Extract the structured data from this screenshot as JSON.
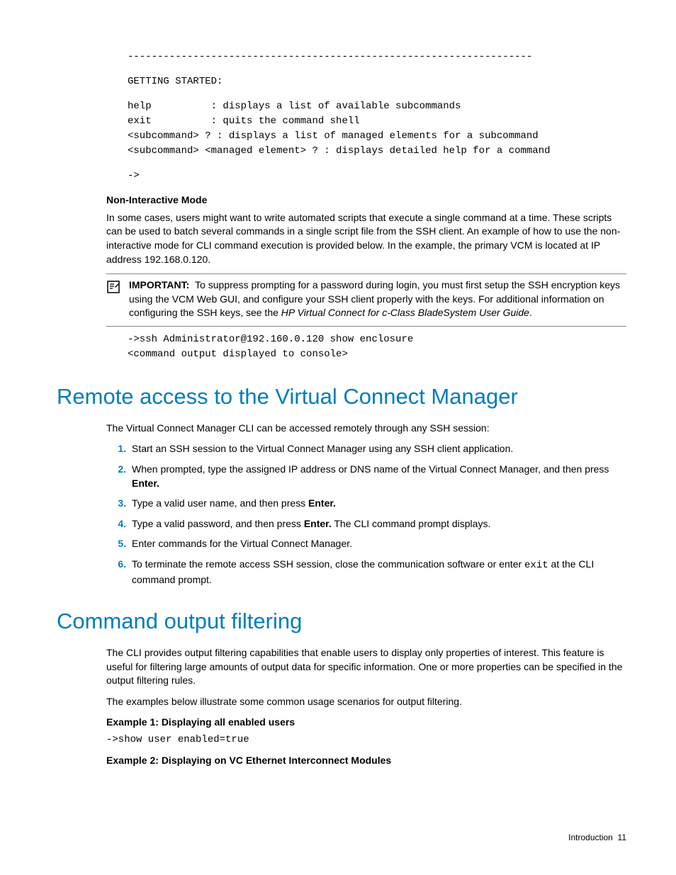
{
  "terminal": {
    "divider": "--------------------------------------------------------------------",
    "heading": "GETTING STARTED:",
    "rows": [
      "help          : displays a list of available subcommands",
      "exit          : quits the command shell",
      "<subcommand> ? : displays a list of managed elements for a subcommand",
      "<subcommand> <managed element> ? : displays detailed help for a command"
    ],
    "prompt": "->"
  },
  "noninteractive": {
    "heading": "Non-Interactive Mode",
    "para": "In some cases, users might want to write automated scripts that execute a single command at a time. These scripts can be used to batch several commands in a single script file from the SSH client. An example of how to use the non-interactive mode for CLI command execution is provided below. In the example, the primary VCM is located at IP address 192.168.0.120.",
    "important_label": "IMPORTANT:",
    "important_body_pre": "To suppress prompting for a password during login, you must first setup the SSH encryption keys using the VCM Web GUI, and configure your SSH client properly with the keys. For additional information on configuring the SSH keys, see the ",
    "important_body_ital": "HP Virtual Connect for c-Class BladeSystem User Guide",
    "important_body_post": ".",
    "code1": "->ssh Administrator@192.160.0.120 show enclosure",
    "code2": "<command output displayed to console>"
  },
  "remote": {
    "title": "Remote access to the Virtual Connect Manager",
    "intro": "The Virtual Connect Manager CLI can be accessed remotely through any SSH session:",
    "steps": [
      {
        "text": "Start an SSH session to the Virtual Connect Manager using any SSH client application."
      },
      {
        "pre": "When prompted, type the assigned IP address or DNS name of the Virtual Connect Manager, and then press ",
        "bold": "Enter."
      },
      {
        "pre": "Type a valid user name, and then press ",
        "bold": "Enter."
      },
      {
        "pre": "Type a valid password, and then press ",
        "bold": "Enter.",
        "post": " The CLI command prompt displays."
      },
      {
        "text": "Enter commands for the Virtual Connect Manager."
      },
      {
        "pre": "To terminate the remote access SSH session, close the communication software or enter ",
        "code": "exit",
        "post": " at the CLI command prompt."
      }
    ]
  },
  "filtering": {
    "title": "Command output filtering",
    "para1": "The CLI provides output filtering capabilities that enable users to display only properties of interest. This feature is useful for filtering large amounts of output data for specific information. One or more properties can be specified in the output filtering rules.",
    "para2": "The examples below illustrate some common usage scenarios for output filtering.",
    "ex1_h": "Example 1: Displaying all enabled users",
    "ex1_code": "->show user enabled=true",
    "ex2_h": "Example 2: Displaying on VC Ethernet Interconnect Modules"
  },
  "footer": {
    "section": "Introduction",
    "page": "11"
  }
}
